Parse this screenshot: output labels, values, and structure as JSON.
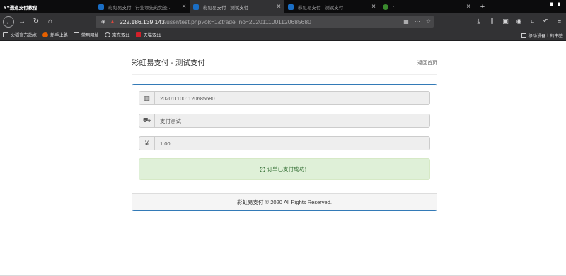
{
  "browser": {
    "tabs": [
      {
        "label": "YY通道支付教程",
        "active": false
      },
      {
        "label": "彩虹易支付 - 行业领先的免签...",
        "active": false
      },
      {
        "label": "彩虹易支付 - 测试支付",
        "active": true
      },
      {
        "label": "彩虹易支付 - 测试支付",
        "active": false
      },
      {
        "label": "-",
        "active": false
      }
    ],
    "new_tab": "+",
    "url_host": "222.186.139.143",
    "url_path": "/user/test.php?ok=1&trade_no=2020111001120685680",
    "bookmarks": [
      "火狐官方站点",
      "新手上路",
      "常用网址",
      "京东双11",
      "天猫双11"
    ],
    "bookmarks_right": "移动设备上的书签"
  },
  "page": {
    "title": "彩虹易支付 - 测试支付",
    "back_home": "返回首页",
    "trade_no": "2020111001120685680",
    "product_name": "支付测试",
    "amount": "1.00",
    "success_message": "订单已支付成功！",
    "footer": "彩虹易支付 © 2020 All Rights Reserved."
  },
  "colors": {
    "panel_border": "#337ab7",
    "success_bg": "#dff0d8",
    "success_text": "#3c763d"
  }
}
